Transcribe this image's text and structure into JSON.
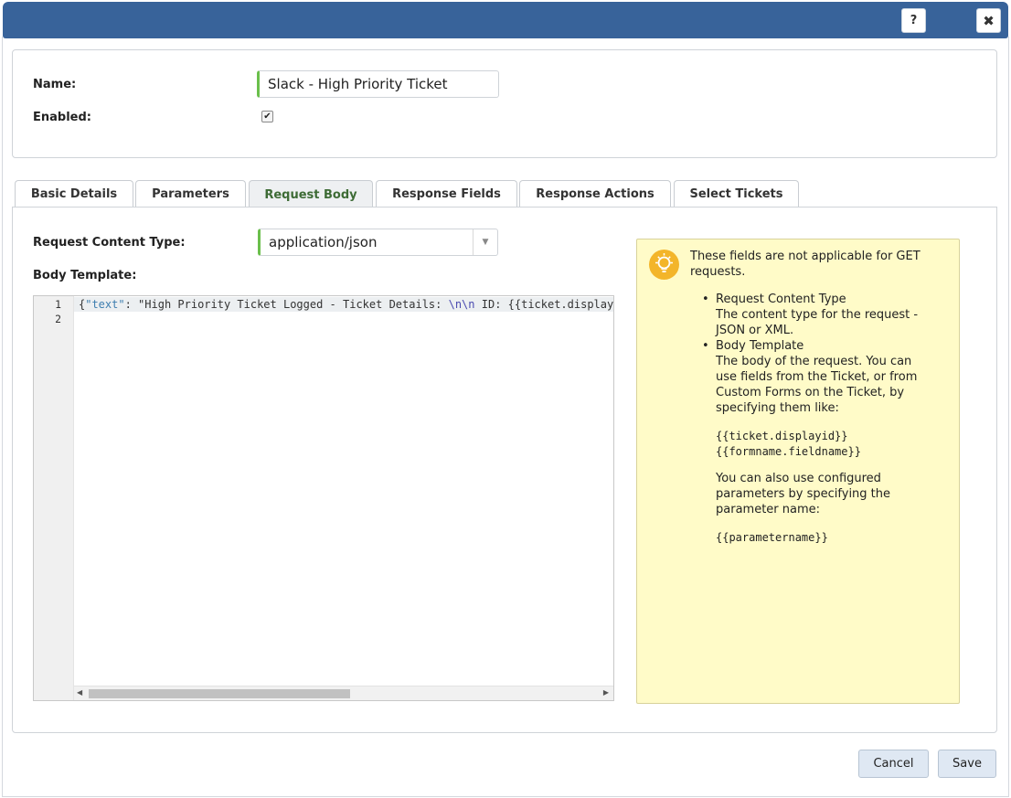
{
  "dialog": {
    "help_label": "?",
    "close_label": "✖"
  },
  "form": {
    "name_label": "Name:",
    "name_value": "Slack - High Priority Ticket",
    "enabled_label": "Enabled:",
    "enabled_checked": true
  },
  "tabs": [
    {
      "label": "Basic Details",
      "active": false
    },
    {
      "label": "Parameters",
      "active": false
    },
    {
      "label": "Request Body",
      "active": true
    },
    {
      "label": "Response Fields",
      "active": false
    },
    {
      "label": "Response Actions",
      "active": false
    },
    {
      "label": "Select Tickets",
      "active": false
    }
  ],
  "request_body": {
    "content_type_label": "Request Content Type:",
    "content_type_value": "application/json",
    "body_template_label": "Body Template:",
    "editor": {
      "line_numbers": [
        "1",
        "2"
      ],
      "line1_part1": "{",
      "line1_key": "\"text\"",
      "line1_part2": ": \"High Priority Ticket Logged - Ticket Details: ",
      "line1_escape": "\\n\\n",
      "line1_part3": " ID: {{ticket.display"
    }
  },
  "info_panel": {
    "icon": "lightbulb-icon",
    "intro": "These fields are not applicable for GET requests.",
    "item1_title": "Request Content Type",
    "item1_desc": "The content type for the request - JSON or XML.",
    "item2_title": "Body Template",
    "item2_desc": "The body of the request. You can use fields from the Ticket, or from Custom Forms on the Ticket, by specifying them like:",
    "example1": "{{ticket.displayid}}",
    "example2": "{{formname.fieldname}}",
    "item2_desc2": "You can also use configured parameters by specifying the parameter name:",
    "example3": "{{parametername}}"
  },
  "footer": {
    "cancel_label": "Cancel",
    "save_label": "Save"
  },
  "colors": {
    "titlebar": "#38639a",
    "info_bg": "#fffbc8",
    "accent_green": "#6abf4b",
    "button_bg": "#dfe8f3"
  }
}
